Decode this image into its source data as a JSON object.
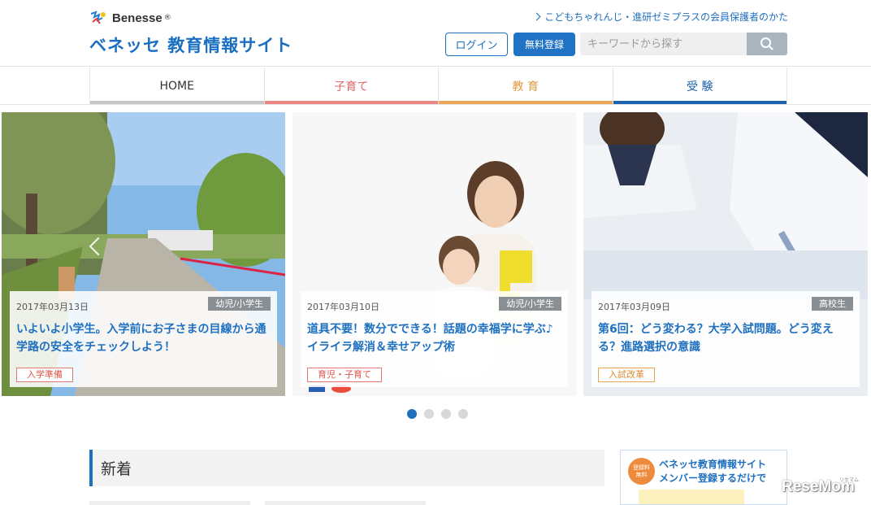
{
  "header": {
    "brand_name": "Benesse",
    "brand_reg": "®",
    "site_title": "ベネッセ 教育情報サイト",
    "member_link": "こどもちゃれんじ・進研ゼミプラスの会員保護者のかた",
    "login_label": "ログイン",
    "register_label": "無料登録",
    "search_placeholder": "キーワードから探す"
  },
  "nav": {
    "tabs": [
      {
        "label": "HOME",
        "color": "#c6c6c6"
      },
      {
        "label": "子育て",
        "color": "#ea8784"
      },
      {
        "label": "教 育",
        "color": "#eba656"
      },
      {
        "label": "受 験",
        "color": "#1b62b0"
      }
    ]
  },
  "carousel": {
    "slides": [
      {
        "date": "2017年03月13日",
        "grade": "幼児/小学生",
        "title": "いよいよ小学生。入学前にお子さまの目線から通学路の安全をチェックしよう！",
        "tag": "入学準備"
      },
      {
        "date": "2017年03月10日",
        "grade": "幼児/小学生",
        "title": "道具不要！数分でできる！話題の幸福学に学ぶ♪イライラ解消＆幸せアップ術",
        "tag": "育児・子育て"
      },
      {
        "date": "2017年03月09日",
        "grade": "高校生",
        "title": "第6回：どう変わる？大学入試問題。どう変える？進路選択の意識",
        "tag": "入試改革"
      }
    ],
    "active_index": 0,
    "dot_count": 4
  },
  "news": {
    "heading": "新着"
  },
  "banner": {
    "badge_line1": "登録料",
    "badge_line2": "無料",
    "title": "ベネッセ教育情報サイト",
    "subtitle": "メンバー登録するだけで"
  },
  "watermark": {
    "text": "ReseMom",
    "sub": "リセマム"
  },
  "colors": {
    "accent": "#1f6fbf",
    "child": "#e26565",
    "education": "#e09a3e",
    "exam": "#1a5ea8"
  }
}
